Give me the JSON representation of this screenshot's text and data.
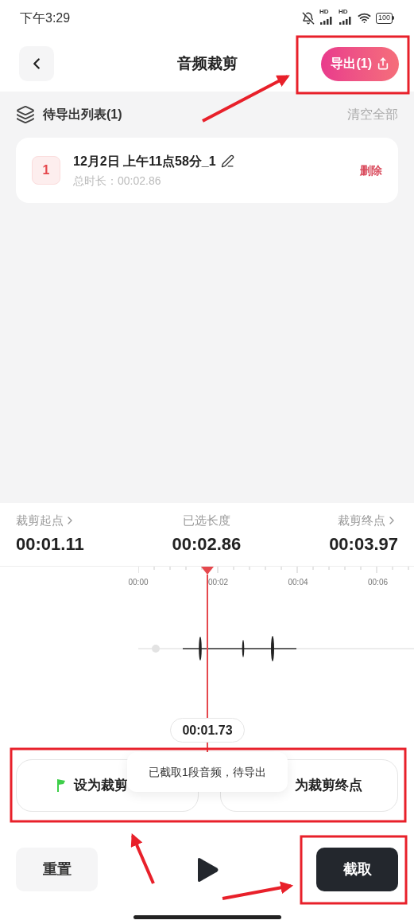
{
  "status_bar": {
    "time": "下午3:29",
    "signal_labels": [
      "HD",
      "HD"
    ],
    "battery": "100"
  },
  "header": {
    "title": "音频裁剪",
    "export_button": "导出(1)"
  },
  "pending_list": {
    "title": "待导出列表(1)",
    "clear_all": "清空全部",
    "items": [
      {
        "index": "1",
        "name": "12月2日 上午11点58分_1",
        "duration": "总时长：00:02.86",
        "delete": "删除"
      }
    ]
  },
  "trim": {
    "start": {
      "label": "裁剪起点",
      "value": "00:01.11"
    },
    "length": {
      "label": "已选长度",
      "value": "00:02.86"
    },
    "end": {
      "label": "裁剪终点",
      "value": "00:03.97"
    }
  },
  "timeline": {
    "ticks": [
      "00:00",
      "00:02",
      "00:04",
      "00:06"
    ],
    "playhead_time": "00:01.73"
  },
  "mark_buttons": {
    "set_start": "设为裁剪",
    "set_end": "为裁剪终点"
  },
  "toast": "已截取1段音频，待导出",
  "controls": {
    "reset": "重置",
    "cut": "截取"
  }
}
